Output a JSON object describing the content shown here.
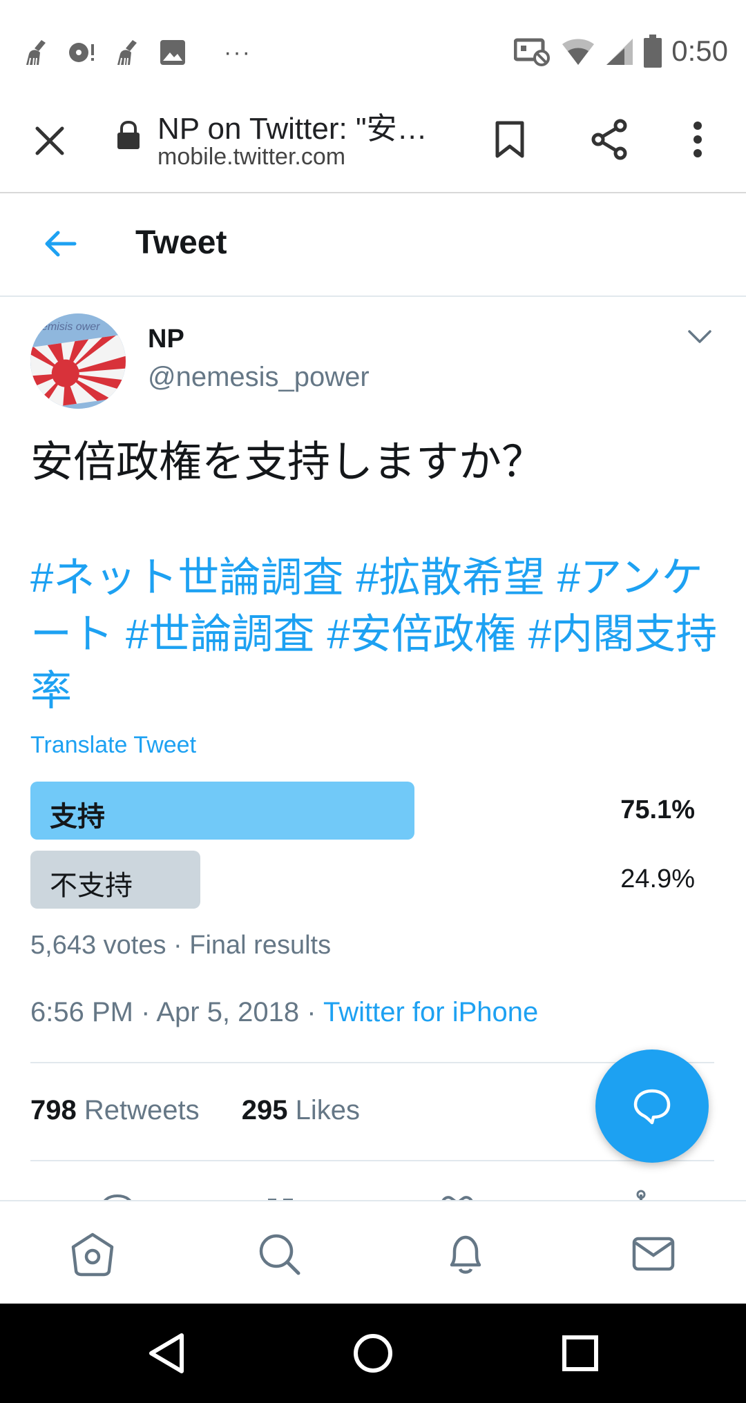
{
  "status_bar": {
    "left_icons": [
      "broom-icon",
      "disc-alert-icon",
      "broom-icon",
      "image-icon"
    ],
    "overflow": "···",
    "right_icons": [
      "cast-off-icon",
      "wifi-icon",
      "signal-icon",
      "battery-icon"
    ],
    "time": "0:50"
  },
  "browser": {
    "title": "NP on Twitter: \"安…",
    "url": "mobile.twitter.com"
  },
  "header": {
    "title": "Tweet"
  },
  "tweet": {
    "author_name": "NP",
    "author_handle": "@nemesis_power",
    "avatar_text": "emisis ower",
    "text": "安倍政権を支持しますか？",
    "hashtags": [
      "#ネット世論調査",
      "#拡散希望",
      "#アンケート",
      "#世論調査",
      "#安倍政権",
      "#内閣支持率"
    ],
    "translate_label": "Translate Tweet",
    "poll": {
      "options": [
        {
          "label": "支持",
          "percent_label": "75.1%",
          "percent": 75.1,
          "winner": true
        },
        {
          "label": "不支持",
          "percent_label": "24.9%",
          "percent": 24.9,
          "winner": false
        }
      ],
      "votes_summary": "5,643 votes · Final results"
    },
    "time": "6:56 PM",
    "date": "Apr 5, 2018",
    "separator": "·",
    "source": "Twitter for iPhone",
    "retweets_count": "798",
    "retweets_label": "Retweets",
    "likes_count": "295",
    "likes_label": "Likes"
  },
  "colors": {
    "accent": "#1da1f2",
    "poll_winner": "#71c9f8",
    "poll_other": "#ccd6dd",
    "secondary_text": "#657786"
  },
  "tabs": [
    "home-icon",
    "search-icon",
    "notifications-icon",
    "messages-icon"
  ],
  "nav": [
    "back-icon",
    "home-icon",
    "recents-icon"
  ]
}
